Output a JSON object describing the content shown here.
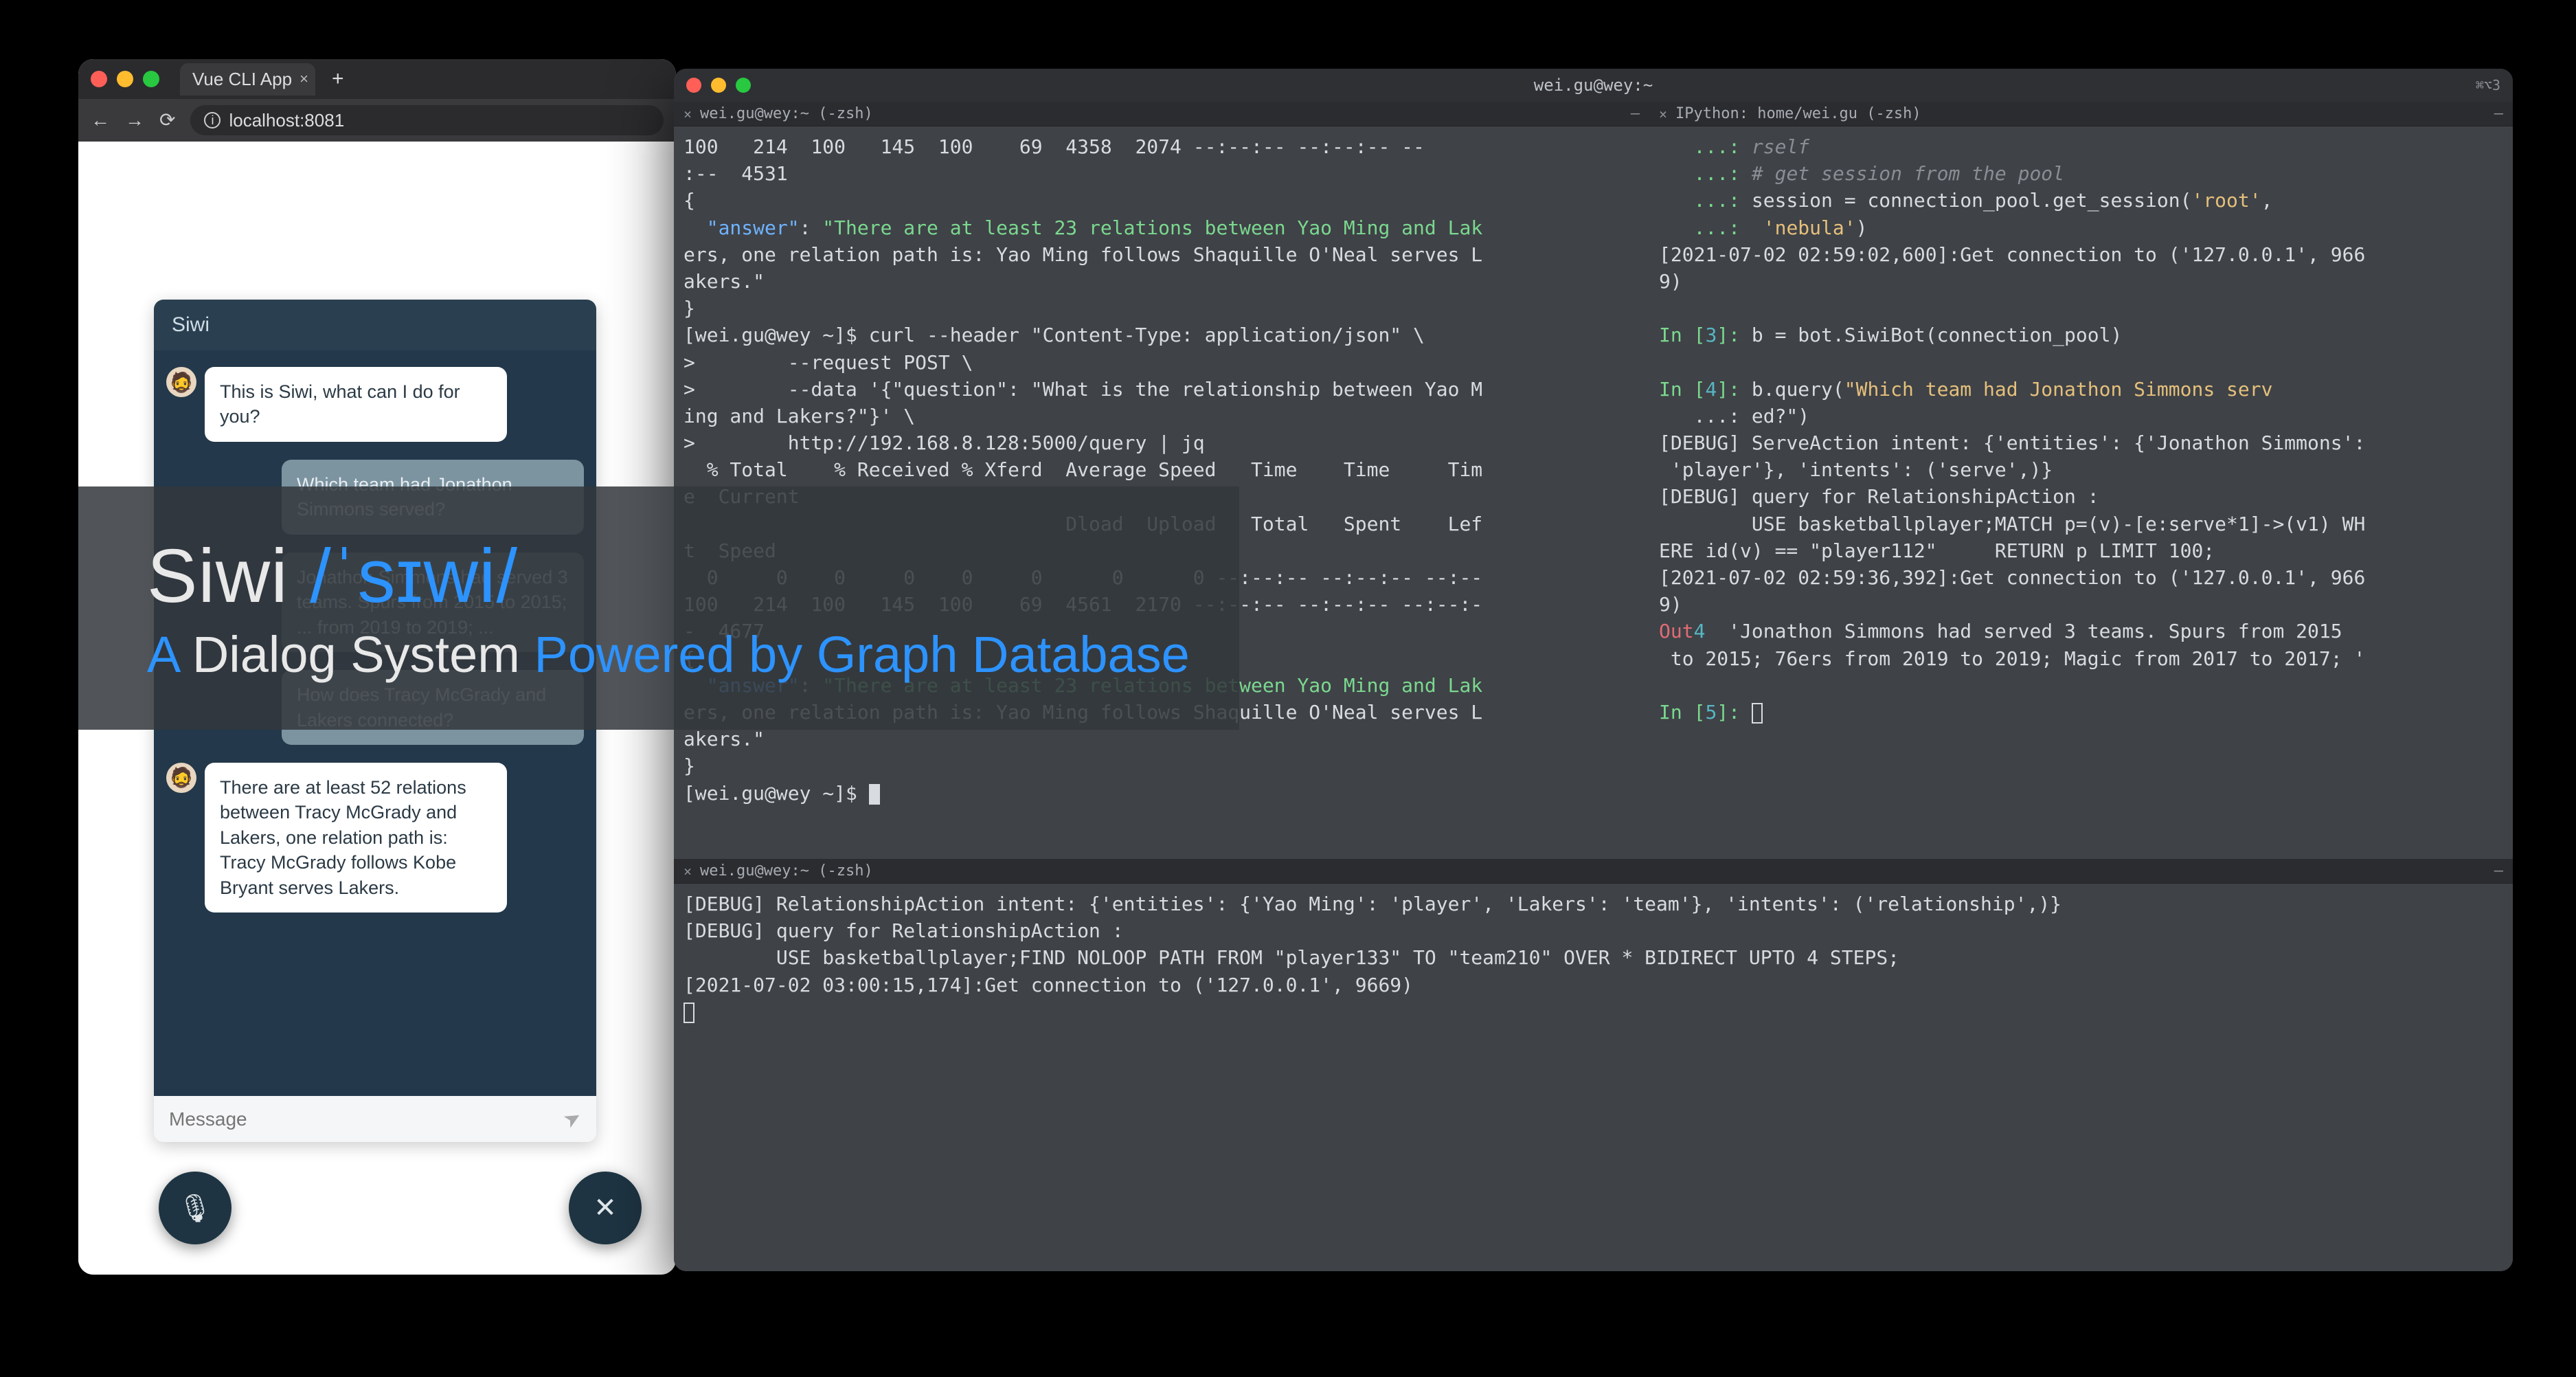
{
  "browser": {
    "tab_title": "Vue CLI App",
    "url": "localhost:8081"
  },
  "chat": {
    "header": "Siwi",
    "messages": [
      {
        "role": "bot",
        "text": "This is Siwi, what can I do for you?"
      },
      {
        "role": "user",
        "text": "Which team had Jonathon Simmons served?"
      },
      {
        "role": "user",
        "text": "Jonathon Simmons had served 3 teams. Spurs from 2015 to 2015; ... from 2019 to 2019; ..."
      },
      {
        "role": "user",
        "text": "How does Tracy McGrady and Lakers connected?"
      },
      {
        "role": "bot",
        "text": "There are at least 52 relations between Tracy McGrady and Lakers, one relation path is: Tracy McGrady follows Kobe Bryant serves Lakers."
      }
    ],
    "placeholder": "Message"
  },
  "hero": {
    "name": "Siwi",
    "phonetic": "/ˈsɪwi/",
    "tagline_a": "A",
    "tagline_b": "Dialog System",
    "tagline_c": "Powered by Graph Database"
  },
  "terminal": {
    "title": "wei.gu@wey:~",
    "right_badge": "⌘⌥3",
    "pane_tl": {
      "tab": "wei.gu@wey:~ (-zsh)",
      "lines": [
        "100   214  100   145  100    69  4358  2074 --:--:-- --:--:-- --",
        ":--  4531",
        "{",
        "  §b§\"answer\"§/§: §g§\"There are at least 23 relations between Yao Ming and Lak",
        "ers, one relation path is: Yao Ming follows Shaquille O'Neal serves L",
        "akers.\"§/§",
        "}",
        "[wei.gu@wey ~]$ curl --header \"Content-Type: application/json\" \\",
        ">        --request POST \\",
        ">        --data '{\"question\": \"What is the relationship between Yao M",
        "ing and Lakers?\"}' \\",
        ">        http://192.168.8.128:5000/query | jq",
        "  % Total    % Received % Xferd  Average Speed   Time    Time     Tim",
        "e  Current",
        "                                 Dload  Upload   Total   Spent    Lef",
        "t  Speed",
        "  0     0    0     0    0     0      0      0 --:--:-- --:--:-- --:--",
        "100   214  100   145  100    69  4561  2170 --:--:-- --:--:-- --:--:-",
        "-  4677",
        "{",
        "  §b§\"answer\"§/§: §g§\"There are at least 23 relations between Yao Ming and Lak",
        "ers, one relation path is: Yao Ming follows Shaquille O'Neal serves L",
        "akers.\"§/§",
        "}",
        "[wei.gu@wey ~]$ █"
      ]
    },
    "pane_tr": {
      "tab": "IPython: home/wei.gu (-zsh)",
      "lines": [
        "   §g§...:§/§ §gr§rself§/§",
        "   §g§...:§/§ §gr§# get session from the pool§/§",
        "   §g§...:§/§ session = connection_pool.get_session(§y§'root'§/§,",
        "   §g§...:§/§  §y§'nebula'§/§)",
        "[2021-07-02 02:59:02,600]:Get connection to ('127.0.0.1', 966",
        "9)",
        "",
        "§g§In [§/§§c§3§/§§g§]:§/§ b = bot.SiwiBot(connection_pool)",
        "",
        "§g§In [§/§§c§4§/§§g§]:§/§ b.query(§y§\"Which team had Jonathon Simmons serv",
        "   ...: ed?\"§/§)",
        "[DEBUG] ServeAction intent: {'entities': {'Jonathon Simmons':",
        " 'player'}, 'intents': ('serve',)}",
        "[DEBUG] query for RelationshipAction :",
        "        USE basketballplayer;MATCH p=(v)-[e:serve*1]->(v1) WH",
        "ERE id(v) == \"player112\"     RETURN p LIMIT 100;",
        "[2021-07-02 02:59:36,392]:Get connection to ('127.0.0.1', 966",
        "9)",
        "§r§Out§/§§c§4§/§  'Jonathon Simmons had served 3 teams. Spurs from 2015",
        " to 2015; 76ers from 2019 to 2019; Magic from 2017 to 2017; '",
        "",
        "§g§In [§/§§c§5§/§§g§]:§/§ ▯"
      ]
    },
    "pane_bot": {
      "tab": "wei.gu@wey:~ (-zsh)",
      "lines": [
        "[DEBUG] RelationshipAction intent: {'entities': {'Yao Ming': 'player', 'Lakers': 'team'}, 'intents': ('relationship',)}",
        "[DEBUG] query for RelationshipAction :",
        "        USE basketballplayer;FIND NOLOOP PATH FROM \"player133\" TO \"team210\" OVER * BIDIRECT UPTO 4 STEPS;",
        "[2021-07-02 03:00:15,174]:Get connection to ('127.0.0.1', 9669)",
        "▯"
      ]
    }
  }
}
